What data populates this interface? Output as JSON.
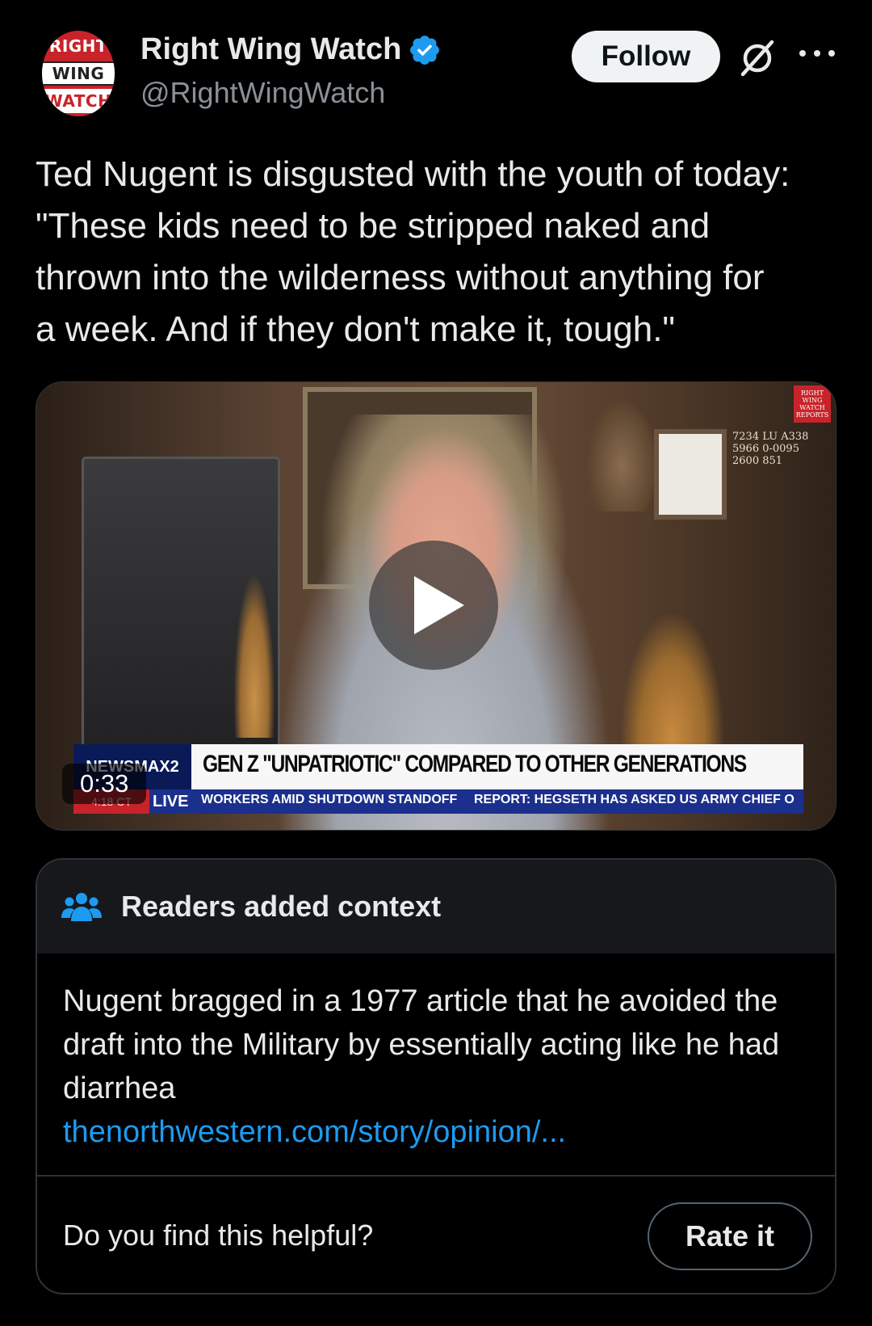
{
  "author": {
    "name": "Right Wing Watch",
    "handle": "@RightWingWatch",
    "avatar_lines": [
      "RIGHT",
      "WING",
      "WATCH"
    ],
    "verified": true
  },
  "actions": {
    "follow_label": "Follow",
    "grok_icon": "grok-icon",
    "more_icon": "more-icon"
  },
  "tweet": {
    "text": "Ted Nugent is disgusted with the youth of today:\n\"These kids need to be stripped naked and\nthrown into the wilderness without anything for\na week. And if they don't make it, tough.\""
  },
  "video": {
    "duration": "0:33",
    "network": "NEWSMAX2",
    "headline": "GEN Z \"UNPATRIOTIC\" COMPARED TO OTHER GENERATIONS",
    "live_label": "LIVE",
    "time_label": "4:18 CT",
    "ticker_1": "WORKERS AMID SHUTDOWN STANDOFF",
    "ticker_2": "REPORT: HEGSETH HAS ASKED US ARMY CHIEF O",
    "watermark": "RIGHT WING WATCH REPORTS",
    "plates": "7234 LU  A338 5966  0-0095 2600  851"
  },
  "context": {
    "title": "Readers added context",
    "body": "Nugent bragged in a 1977 article that he avoided the draft into the Military by essentially acting like he had diarrhea",
    "link": "thenorthwestern.com/story/opinion/...",
    "helpful_prompt": "Do you find this helpful?",
    "rate_label": "Rate it"
  },
  "colors": {
    "background": "#000000",
    "text": "#e7e9ea",
    "secondary_text": "#8b9096",
    "link": "#1d9bf0",
    "verified": "#1d9bf0",
    "card_header": "#16181c",
    "border": "#2f3336"
  }
}
